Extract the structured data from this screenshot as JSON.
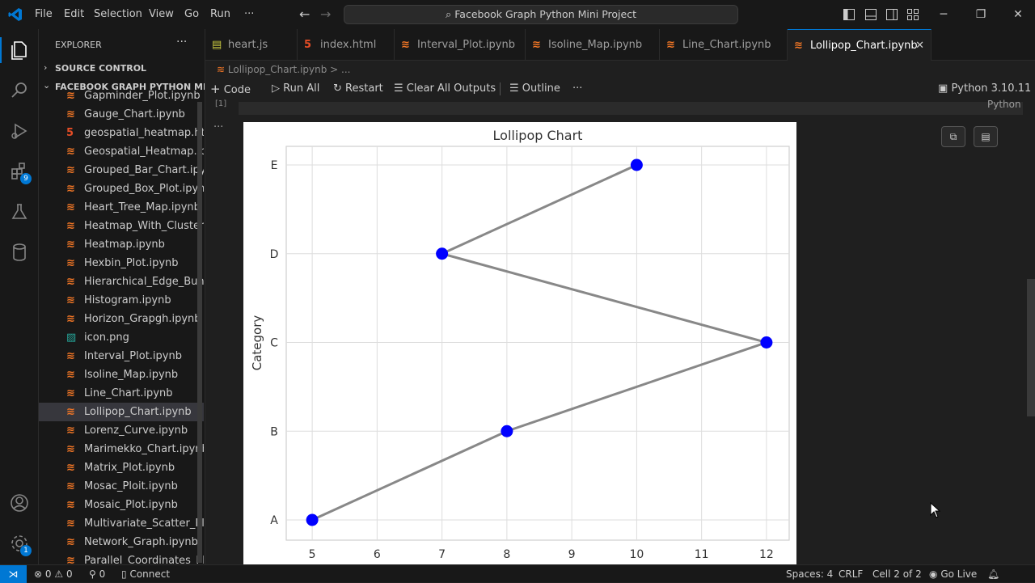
{
  "menu": [
    "File",
    "Edit",
    "Selection",
    "View",
    "Go",
    "Run",
    "···"
  ],
  "search": "Facebook Graph Python Mini Project",
  "explorer": {
    "title": "EXPLORER",
    "source_control": "SOURCE CONTROL",
    "folder": "FACEBOOK GRAPH PYTHON MI...",
    "files": [
      {
        "name": "Gapminder_Plot.ipynb",
        "kind": "ipynb"
      },
      {
        "name": "Gauge_Chart.ipynb",
        "kind": "ipynb"
      },
      {
        "name": "geospatial_heatmap.html",
        "kind": "html"
      },
      {
        "name": "Geospatial_Heatmap.ip...",
        "kind": "ipynb"
      },
      {
        "name": "Grouped_Bar_Chart.ipy...",
        "kind": "ipynb"
      },
      {
        "name": "Grouped_Box_Plot.ipynb",
        "kind": "ipynb"
      },
      {
        "name": "Heart_Tree_Map.ipynb",
        "kind": "ipynb"
      },
      {
        "name": "Heatmap_With_Clusteri...",
        "kind": "ipynb"
      },
      {
        "name": "Heatmap.ipynb",
        "kind": "ipynb"
      },
      {
        "name": "Hexbin_Plot.ipynb",
        "kind": "ipynb"
      },
      {
        "name": "Hierarchical_Edge_Bun...",
        "kind": "ipynb"
      },
      {
        "name": "Histogram.ipynb",
        "kind": "ipynb"
      },
      {
        "name": "Horizon_Grapgh.ipynb",
        "kind": "ipynb"
      },
      {
        "name": "icon.png",
        "kind": "png"
      },
      {
        "name": "Interval_Plot.ipynb",
        "kind": "ipynb"
      },
      {
        "name": "Isoline_Map.ipynb",
        "kind": "ipynb"
      },
      {
        "name": "Line_Chart.ipynb",
        "kind": "ipynb"
      },
      {
        "name": "Lollipop_Chart.ipynb",
        "kind": "ipynb",
        "active": true
      },
      {
        "name": "Lorenz_Curve.ipynb",
        "kind": "ipynb"
      },
      {
        "name": "Marimekko_Chart.ipynb",
        "kind": "ipynb"
      },
      {
        "name": "Matrix_Plot.ipynb",
        "kind": "ipynb"
      },
      {
        "name": "Mosac_Ploit.ipynb",
        "kind": "ipynb"
      },
      {
        "name": "Mosaic_Plot.ipynb",
        "kind": "ipynb"
      },
      {
        "name": "Multivariate_Scatter_Pl...",
        "kind": "ipynb"
      },
      {
        "name": "Network_Graph.ipynb",
        "kind": "ipynb"
      },
      {
        "name": "Parallel_Coordinates_Pl...",
        "kind": "ipynb"
      }
    ]
  },
  "tabs": [
    {
      "label": "heart.js",
      "kind": "js"
    },
    {
      "label": "index.html",
      "kind": "html"
    },
    {
      "label": "Interval_Plot.ipynb",
      "kind": "ipynb"
    },
    {
      "label": "Isoline_Map.ipynb",
      "kind": "ipynb"
    },
    {
      "label": "Line_Chart.ipynb",
      "kind": "ipynb"
    },
    {
      "label": "Lollipop_Chart.ipynb",
      "kind": "ipynb",
      "active": true
    }
  ],
  "breadcrumb": "Lollipop_Chart.ipynb > ...",
  "toolbar": {
    "code": "Code",
    "run_all": "Run All",
    "restart": "Restart",
    "clear": "Clear All Outputs",
    "outline": "Outline",
    "more": "···",
    "kernel": "Python 3.10.11",
    "language": "Python"
  },
  "cell": {
    "exec_count": "[1]",
    "output_more": "···"
  },
  "badges": {
    "extensions": "9",
    "settings": "1"
  },
  "chart_data": {
    "type": "line",
    "title": "Lollipop Chart",
    "xlabel": "",
    "ylabel": "Category",
    "x_ticks": [
      "5",
      "6",
      "7",
      "8",
      "9",
      "10",
      "11",
      "12"
    ],
    "xlim": [
      4.6,
      12.35
    ],
    "categories": [
      "A",
      "B",
      "C",
      "D",
      "E"
    ],
    "points": [
      {
        "category": "A",
        "value": 5
      },
      {
        "category": "B",
        "value": 8
      },
      {
        "category": "C",
        "value": 12
      },
      {
        "category": "D",
        "value": 7
      },
      {
        "category": "E",
        "value": 10
      }
    ],
    "grid": true,
    "line_color": "#888888",
    "marker_color": "#0000ff"
  },
  "status": {
    "errors": "0",
    "warnings": "0",
    "ports": "0",
    "connect": "Connect",
    "spaces": "Spaces: 4",
    "eol": "CRLF",
    "cell": "Cell 2 of 2",
    "golive": "Go Live"
  },
  "colors": {
    "accent": "#0078d4",
    "ipynb_icon": "#f37726",
    "html_icon": "#e44d26",
    "js_icon": "#cbcb41",
    "png_icon": "#26a69a"
  }
}
